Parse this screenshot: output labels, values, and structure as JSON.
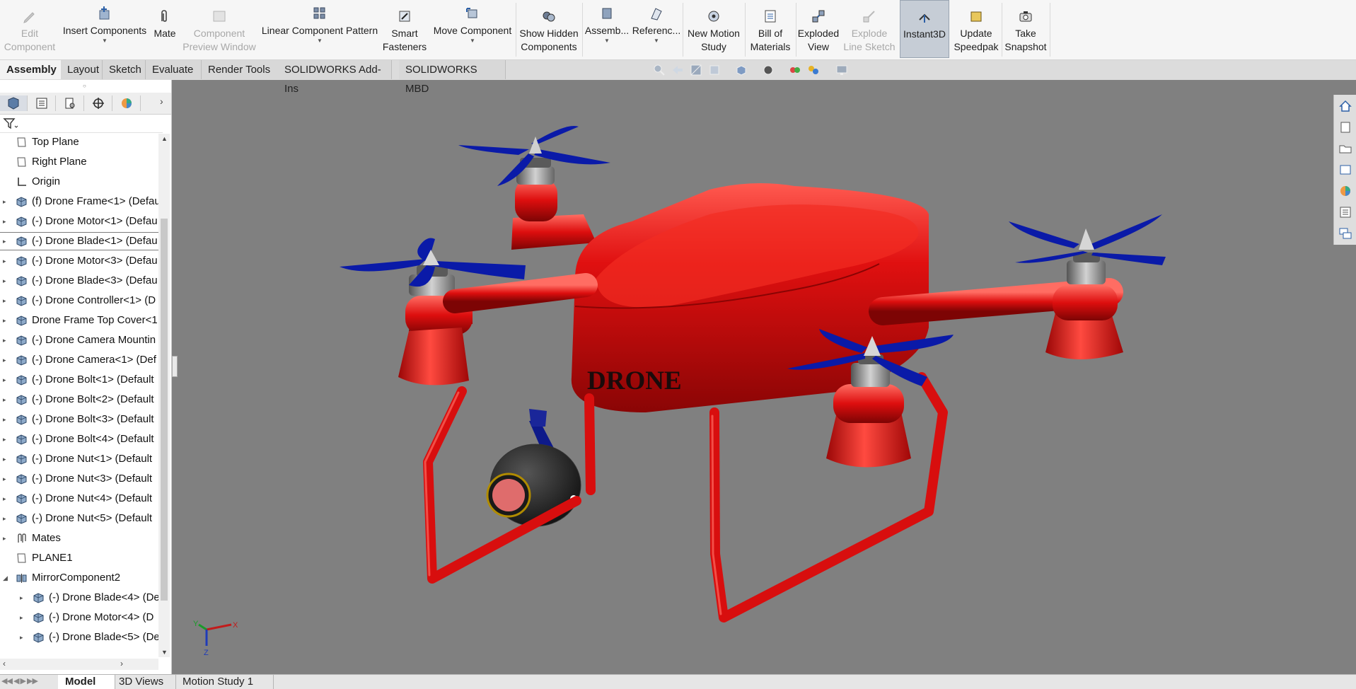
{
  "ribbon": {
    "buttons": [
      {
        "label": "Edit\nComponent",
        "disabled": true,
        "icon": "edit-component-icon"
      },
      {
        "label": "Insert Components",
        "disabled": false,
        "icon": "insert-components-icon"
      },
      {
        "label": "Mate",
        "disabled": false,
        "icon": "mate-icon"
      },
      {
        "label": "Component\nPreview Window",
        "disabled": true,
        "icon": "preview-window-icon"
      },
      {
        "label": "Linear Component Pattern",
        "disabled": false,
        "icon": "linear-pattern-icon"
      },
      {
        "label": "Smart\nFasteners",
        "disabled": false,
        "icon": "smart-fasteners-icon"
      },
      {
        "label": "Move Component",
        "disabled": false,
        "icon": "move-component-icon"
      },
      {
        "label": "Show Hidden\nComponents",
        "disabled": false,
        "icon": "show-hidden-icon"
      },
      {
        "label": "Assemb...",
        "disabled": false,
        "icon": "assembly-features-icon"
      },
      {
        "label": "Referenc...",
        "disabled": false,
        "icon": "reference-geometry-icon"
      },
      {
        "label": "New Motion\nStudy",
        "disabled": false,
        "icon": "motion-study-icon"
      },
      {
        "label": "Bill of\nMaterials",
        "disabled": false,
        "icon": "bom-icon"
      },
      {
        "label": "Exploded\nView",
        "disabled": false,
        "icon": "exploded-view-icon"
      },
      {
        "label": "Explode\nLine Sketch",
        "disabled": true,
        "icon": "explode-line-icon"
      },
      {
        "label": "Instant3D",
        "disabled": false,
        "icon": "instant3d-icon"
      },
      {
        "label": "Update\nSpeedpak",
        "disabled": false,
        "icon": "speedpak-icon"
      },
      {
        "label": "Take\nSnapshot",
        "disabled": false,
        "icon": "camera-icon"
      }
    ]
  },
  "tabs": [
    "Assembly",
    "Layout",
    "Sketch",
    "Evaluate",
    "Render Tools",
    "SOLIDWORKS Add-Ins",
    "SOLIDWORKS MBD"
  ],
  "tree": {
    "items": [
      {
        "label": "Top Plane",
        "icon": "plane-icon",
        "expand": false
      },
      {
        "label": "Right Plane",
        "icon": "plane-icon",
        "expand": false
      },
      {
        "label": "Origin",
        "icon": "origin-icon",
        "expand": false
      },
      {
        "label": "(f) Drone Frame<1> (Defau",
        "icon": "part-icon",
        "expand": true
      },
      {
        "label": "(-) Drone Motor<1> (Defau",
        "icon": "part-icon",
        "expand": true
      },
      {
        "label": "(-) Drone Blade<1> (Defau",
        "icon": "part-icon",
        "expand": true
      },
      {
        "label": "(-) Drone Motor<3> (Defau",
        "icon": "part-icon",
        "expand": true
      },
      {
        "label": "(-) Drone Blade<3> (Defau",
        "icon": "part-icon",
        "expand": true
      },
      {
        "label": "(-) Drone Controller<1> (D",
        "icon": "part-icon",
        "expand": true
      },
      {
        "label": "Drone Frame Top Cover<1",
        "icon": "part-icon",
        "expand": true
      },
      {
        "label": "(-) Drone Camera Mountin",
        "icon": "part-icon",
        "expand": true
      },
      {
        "label": "(-) Drone Camera<1> (Def",
        "icon": "part-icon",
        "expand": true
      },
      {
        "label": "(-) Drone Bolt<1> (Default",
        "icon": "part-icon",
        "expand": true
      },
      {
        "label": "(-) Drone Bolt<2> (Default",
        "icon": "part-icon",
        "expand": true
      },
      {
        "label": "(-) Drone Bolt<3> (Default",
        "icon": "part-icon",
        "expand": true
      },
      {
        "label": "(-) Drone Bolt<4> (Default",
        "icon": "part-icon",
        "expand": true
      },
      {
        "label": "(-) Drone Nut<1> (Default",
        "icon": "part-icon",
        "expand": true
      },
      {
        "label": "(-) Drone Nut<3> (Default",
        "icon": "part-icon",
        "expand": true
      },
      {
        "label": "(-) Drone Nut<4> (Default",
        "icon": "part-icon",
        "expand": true
      },
      {
        "label": "(-) Drone Nut<5> (Default",
        "icon": "part-icon",
        "expand": true
      },
      {
        "label": "Mates",
        "icon": "mates-icon",
        "expand": true
      },
      {
        "label": "PLANE1",
        "icon": "plane-icon",
        "expand": false
      },
      {
        "label": "MirrorComponent2",
        "icon": "mirror-component-icon",
        "expand": "open"
      },
      {
        "label": "(-) Drone Blade<4> (De",
        "icon": "part-icon",
        "expand": true,
        "indent": true
      },
      {
        "label": "(-) Drone Motor<4> (D",
        "icon": "part-icon",
        "expand": true,
        "indent": true
      },
      {
        "label": "(-) Drone Blade<5> (De",
        "icon": "part-icon",
        "expand": true,
        "indent": true
      }
    ],
    "selected_index": 5
  },
  "model": {
    "label": "DRONE",
    "body_color": "#e01010",
    "blade_color": "#0a1aa8"
  },
  "triad": {
    "x": "X",
    "y": "Y",
    "z": "Z"
  },
  "bottom_tabs": [
    "Model",
    "3D Views",
    "Motion Study 1"
  ],
  "colors": {
    "ribbon_bg": "#f6f6f6",
    "viewport_bg": "#808080",
    "accent": "#2b5fa6"
  }
}
